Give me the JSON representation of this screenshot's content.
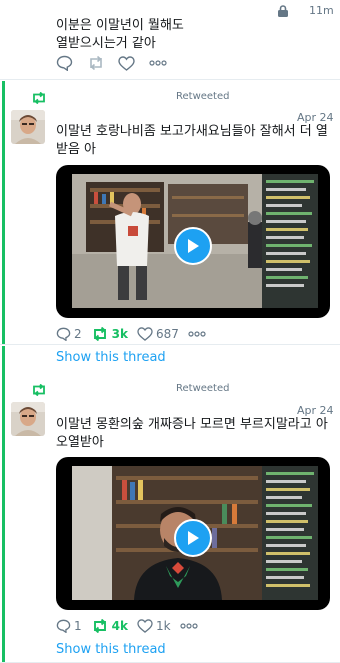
{
  "top_tweet": {
    "time": "11m",
    "text": "이분은 이말년이 뭘해도\n열받으시는거 같아"
  },
  "tweets": [
    {
      "retweet_label": "Retweeted",
      "date": "Apr 24",
      "text": "이말년 호랑나비좀 보고가새요님들아 잘해서 더 열받음 아",
      "replies": "2",
      "retweets": "3k",
      "likes": "687",
      "thread_link": "Show this thread"
    },
    {
      "retweet_label": "Retweeted",
      "date": "Apr 24",
      "text": "이말년 몽환의숲 개짜증나 모르면 부르지말라고 아오열받아",
      "replies": "1",
      "retweets": "4k",
      "likes": "1k",
      "thread_link": "Show this thread"
    }
  ],
  "icons": {
    "lock": "lock-icon",
    "reply": "reply-icon",
    "retweet": "retweet-icon",
    "like": "heart-icon",
    "more": "more-icon",
    "play": "play-icon"
  },
  "colors": {
    "accent_green": "#17bf63",
    "link_blue": "#1da1f2",
    "muted": "#657786"
  }
}
